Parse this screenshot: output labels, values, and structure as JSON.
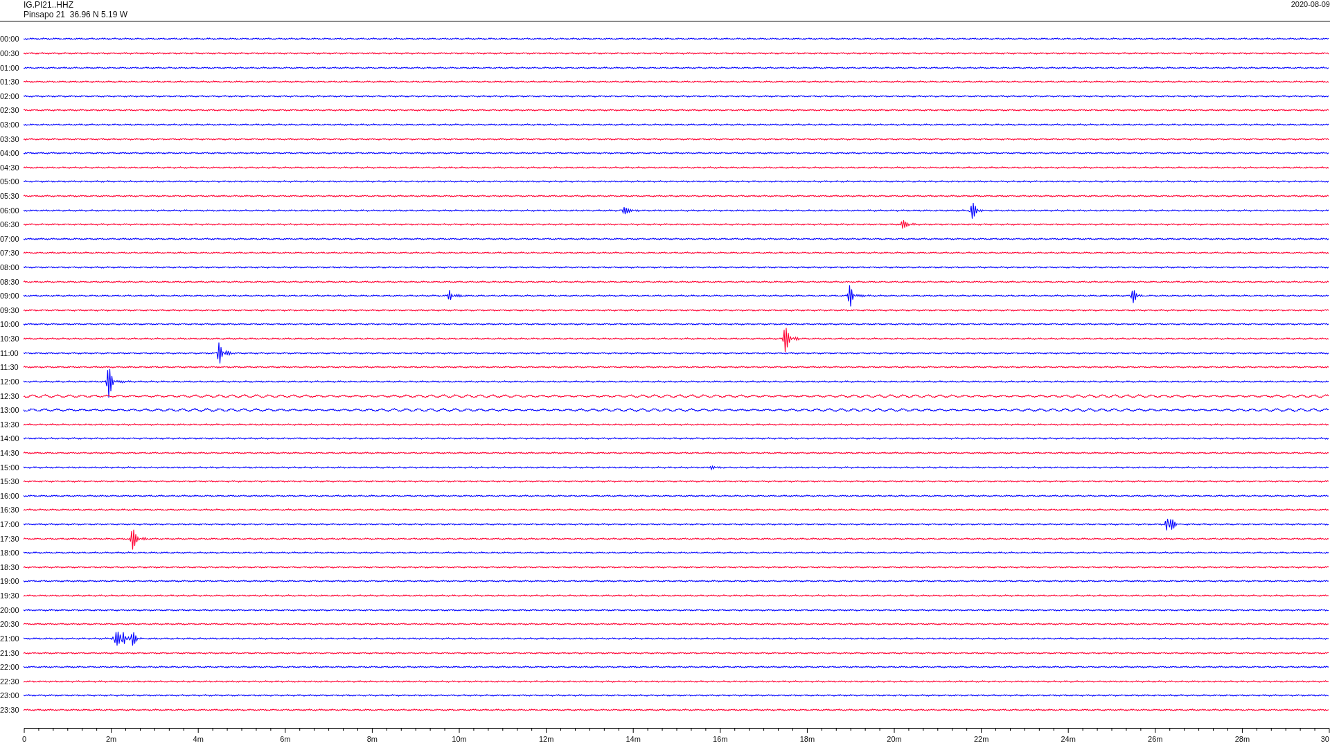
{
  "header": {
    "station": "IG.PI21..HHZ",
    "location": "Pinsapo 21  36.96 N 5.19 W",
    "date": "2020-08-09"
  },
  "rows": [
    {
      "time": "00:00",
      "color": "#0000ff"
    },
    {
      "time": "00:30",
      "color": "#ff0033"
    },
    {
      "time": "01:00",
      "color": "#0000ff"
    },
    {
      "time": "01:30",
      "color": "#ff0033"
    },
    {
      "time": "02:00",
      "color": "#0000ff"
    },
    {
      "time": "02:30",
      "color": "#ff0033"
    },
    {
      "time": "03:00",
      "color": "#0000ff"
    },
    {
      "time": "03:30",
      "color": "#ff0033"
    },
    {
      "time": "04:00",
      "color": "#0000ff"
    },
    {
      "time": "04:30",
      "color": "#ff0033"
    },
    {
      "time": "05:00",
      "color": "#0000ff"
    },
    {
      "time": "05:30",
      "color": "#ff0033"
    },
    {
      "time": "06:00",
      "color": "#0000ff"
    },
    {
      "time": "06:30",
      "color": "#ff0033"
    },
    {
      "time": "07:00",
      "color": "#0000ff"
    },
    {
      "time": "07:30",
      "color": "#ff0033"
    },
    {
      "time": "08:00",
      "color": "#0000ff"
    },
    {
      "time": "08:30",
      "color": "#ff0033"
    },
    {
      "time": "09:00",
      "color": "#0000ff"
    },
    {
      "time": "09:30",
      "color": "#ff0033"
    },
    {
      "time": "10:00",
      "color": "#0000ff"
    },
    {
      "time": "10:30",
      "color": "#ff0033"
    },
    {
      "time": "11:00",
      "color": "#0000ff"
    },
    {
      "time": "11:30",
      "color": "#ff0033"
    },
    {
      "time": "12:00",
      "color": "#0000ff"
    },
    {
      "time": "12:30",
      "color": "#ff0033"
    },
    {
      "time": "13:00",
      "color": "#0000ff"
    },
    {
      "time": "13:30",
      "color": "#ff0033"
    },
    {
      "time": "14:00",
      "color": "#0000ff"
    },
    {
      "time": "14:30",
      "color": "#ff0033"
    },
    {
      "time": "15:00",
      "color": "#0000ff"
    },
    {
      "time": "15:30",
      "color": "#ff0033"
    },
    {
      "time": "16:00",
      "color": "#0000ff"
    },
    {
      "time": "16:30",
      "color": "#ff0033"
    },
    {
      "time": "17:00",
      "color": "#0000ff"
    },
    {
      "time": "17:30",
      "color": "#ff0033"
    },
    {
      "time": "18:00",
      "color": "#0000ff"
    },
    {
      "time": "18:30",
      "color": "#ff0033"
    },
    {
      "time": "19:00",
      "color": "#0000ff"
    },
    {
      "time": "19:30",
      "color": "#ff0033"
    },
    {
      "time": "20:00",
      "color": "#0000ff"
    },
    {
      "time": "20:30",
      "color": "#ff0033"
    },
    {
      "time": "21:00",
      "color": "#0000ff"
    },
    {
      "time": "21:30",
      "color": "#ff0033"
    },
    {
      "time": "22:00",
      "color": "#0000ff"
    },
    {
      "time": "22:30",
      "color": "#ff0033"
    },
    {
      "time": "23:00",
      "color": "#0000ff"
    },
    {
      "time": "23:30",
      "color": "#ff0033"
    }
  ],
  "axis": {
    "ticks": [
      "0",
      "2m",
      "4m",
      "6m",
      "8m",
      "10m",
      "12m",
      "14m",
      "16m",
      "18m",
      "20m",
      "22m",
      "24m",
      "26m",
      "28m",
      "30"
    ]
  }
}
